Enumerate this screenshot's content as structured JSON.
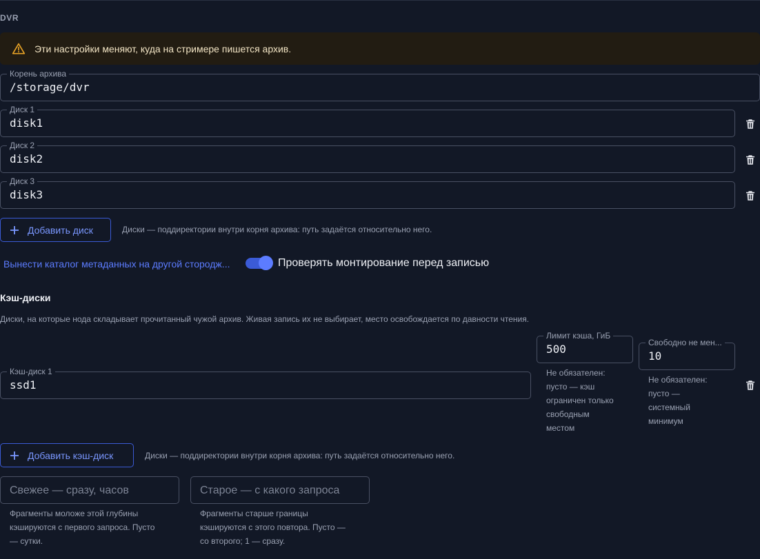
{
  "section_label": "DVR",
  "alert": {
    "icon": "warning-triangle-icon",
    "text": "Эти настройки меняют, куда на стримере пишется архив.",
    "color": "#e8a326"
  },
  "archive_root": {
    "label": "Корень архива",
    "value": "/storage/dvr"
  },
  "disks": [
    {
      "label": "Диск 1",
      "value": "disk1"
    },
    {
      "label": "Диск 2",
      "value": "disk2"
    },
    {
      "label": "Диск 3",
      "value": "disk3"
    }
  ],
  "add_disk": {
    "label": "Добавить диск",
    "hint": "Диски — поддиректории внутри корня архива: путь задаётся относительно него."
  },
  "metadata_link": "Вынести каталог метаданных на другой стородж...",
  "mount_check": {
    "label": "Проверять монтирование перед записью",
    "enabled": true
  },
  "cache": {
    "heading": "Кэш-диски",
    "description": "Диски, на которые нода складывает прочитанный чужой архив. Живая запись их не выбирает, место освобождается по давности чтения.",
    "disks": [
      {
        "label": "Кэш-диск 1",
        "value": "ssd1",
        "limit": {
          "label": "Лимит кэша, ГиБ",
          "value": "500",
          "help": [
            "Не обязателен:",
            "пусто — кэш",
            "ограничен только",
            "свободным",
            "местом"
          ]
        },
        "free": {
          "label": "Свободно не мен...",
          "value": "10",
          "help": [
            "Не обязателен:",
            "пусто —",
            "системный",
            "минимум"
          ]
        }
      }
    ],
    "add_button": "Добавить кэш-диск",
    "add_hint": "Диски — поддиректории внутри корня архива: путь задаётся относительно него.",
    "fresh": {
      "placeholder": "Свежее — сразу, часов",
      "help": [
        "Фрагменты моложе этой глубины",
        "кэшируются с первого запроса. Пусто",
        "— сутки."
      ]
    },
    "old": {
      "placeholder": "Старое — с какого запроса",
      "help": [
        "Фрагменты старше границы",
        "кэшируются с этого повтора. Пусто —",
        "со второго; 1 — сразу."
      ]
    }
  },
  "colors": {
    "background": "#121826",
    "accent": "#5c7cff",
    "border": "#4a5164"
  }
}
